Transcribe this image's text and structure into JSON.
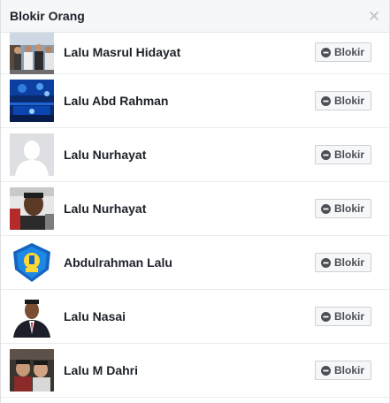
{
  "dialog": {
    "title": "Blokir Orang",
    "close_icon": "close-x-icon"
  },
  "people": [
    {
      "name": "Lalu Masrul Hidayat",
      "button": "Blokir",
      "avatar": "group-photo"
    },
    {
      "name": "Lalu Abd Rahman",
      "button": "Blokir",
      "avatar": "blue-lights-photo"
    },
    {
      "name": "Lalu Nurhayat",
      "button": "Blokir",
      "avatar": "default-silhouette"
    },
    {
      "name": "Lalu Nurhayat",
      "button": "Blokir",
      "avatar": "portrait-photo"
    },
    {
      "name": "Abdulrahman Lalu",
      "button": "Blokir",
      "avatar": "emblem-logo"
    },
    {
      "name": "Lalu Nasai",
      "button": "Blokir",
      "avatar": "suit-portrait-photo"
    },
    {
      "name": "Lalu M Dahri",
      "button": "Blokir",
      "avatar": "two-children-photo"
    }
  ],
  "colors": {
    "header_bg": "#f6f7f9",
    "button_bg": "#f6f7f9",
    "button_border": "#ced0d4",
    "text": "#1d2129",
    "divider": "#e9ebee"
  }
}
